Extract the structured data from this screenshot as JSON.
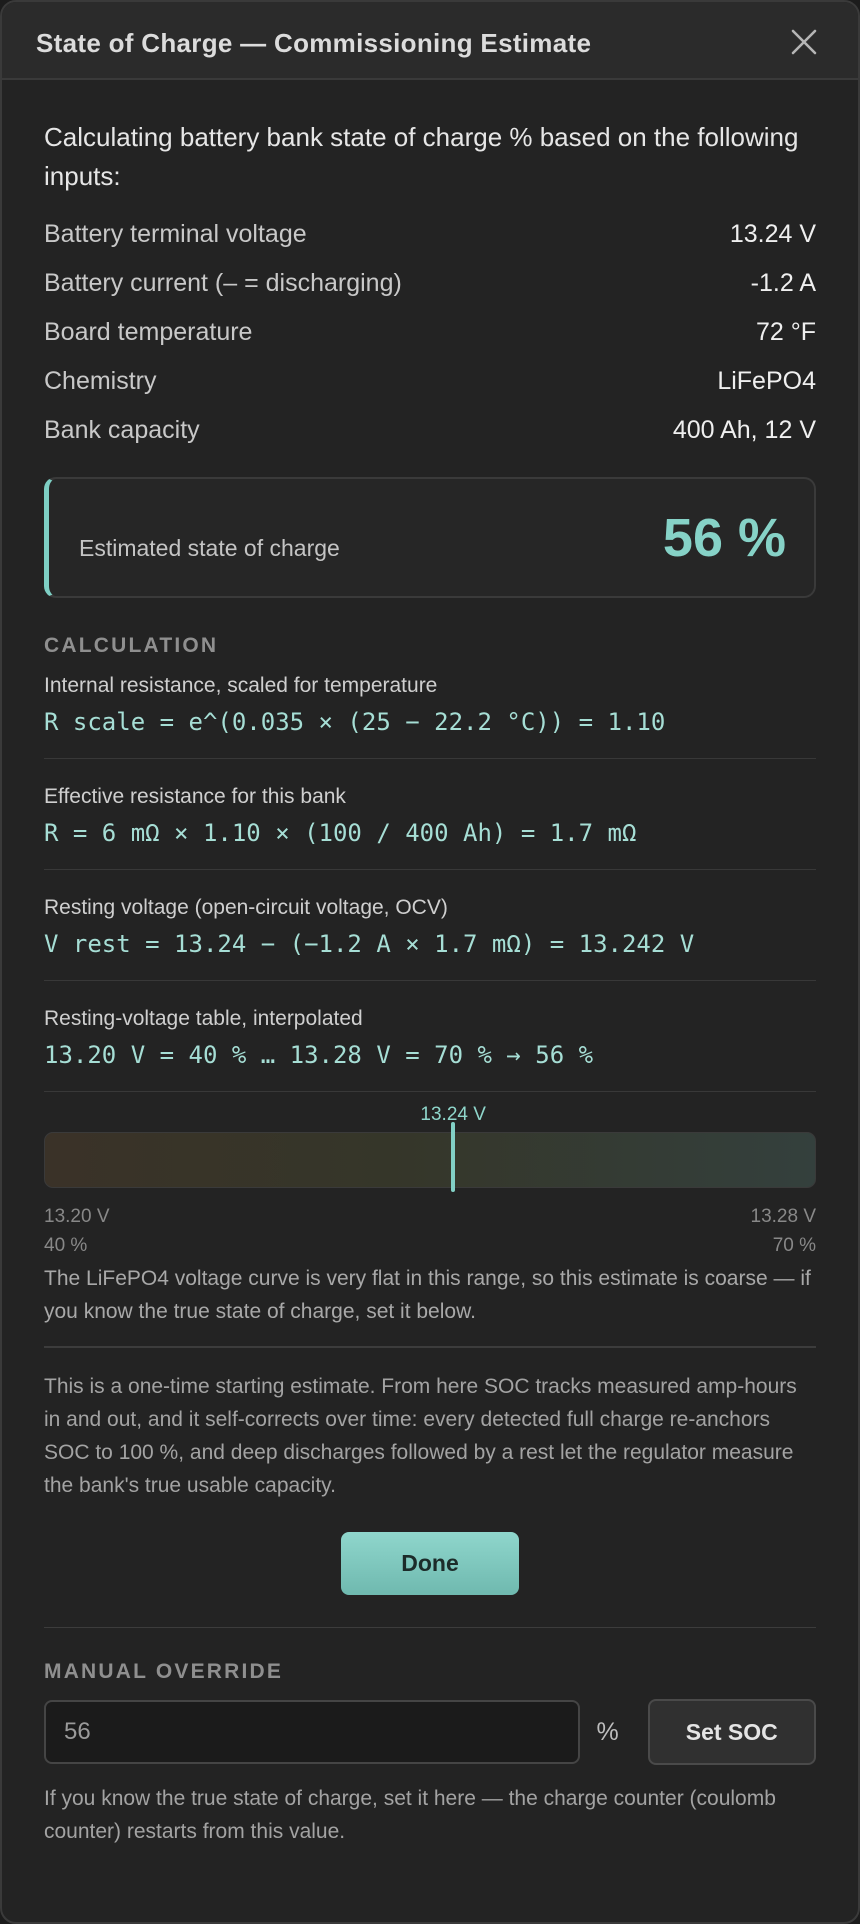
{
  "dialog": {
    "title": "State of Charge — Commissioning Estimate"
  },
  "intro": "Calculating battery bank state of charge % based on the following inputs:",
  "inputs": [
    {
      "label": "Battery terminal voltage",
      "value": "13.24 V"
    },
    {
      "label": "Battery current (– = discharging)",
      "value": "-1.2 A"
    },
    {
      "label": "Board temperature",
      "value": "72 °F"
    },
    {
      "label": "Chemistry",
      "value": "LiFePO4"
    },
    {
      "label": "Bank capacity",
      "value": "400 Ah, 12 V"
    }
  ],
  "estimate": {
    "label": "Estimated state of charge",
    "value": "56 %"
  },
  "calculation": {
    "title": "CALCULATION",
    "steps": [
      {
        "desc": "Internal resistance, scaled for temperature",
        "formula": "R scale = e^(0.035 × (25 − 22.2 °C)) = 1.10"
      },
      {
        "desc": "Effective resistance for this bank",
        "formula": "R = 6 mΩ × 1.10 × (100 / 400 Ah) = 1.7 mΩ"
      },
      {
        "desc": "Resting voltage (open-circuit voltage, OCV)",
        "formula": "V rest = 13.24 − (−1.2 A × 1.7 mΩ) = 13.242 V"
      },
      {
        "desc": "Resting-voltage table, interpolated",
        "formula": "13.20 V = 40 % … 13.28 V = 70 % → 56 %"
      }
    ]
  },
  "gauge": {
    "marker_label": "13.24 V",
    "marker_fraction": 0.53,
    "min_voltage": "13.20 V",
    "min_soc": "40 %",
    "max_voltage": "13.28 V",
    "max_soc": "70 %",
    "note": "The LiFePO4 voltage curve is very flat in this range, so this estimate is coarse — if you know the true state of charge, set it below."
  },
  "info": "This is a one-time starting estimate. From here SOC tracks measured amp-hours in and out, and it self-corrects over time: every detected full charge re-anchors SOC to 100 %, and deep discharges followed by a rest let the regulator measure the bank's true usable capacity.",
  "done_label": "Done",
  "override": {
    "title": "MANUAL OVERRIDE",
    "input_value": "56",
    "unit": "%",
    "button_label": "Set SOC",
    "note": "If you know the true state of charge, set it here — the charge counter (coulomb counter) restarts from this value."
  },
  "colors": {
    "accent": "#86d2c7",
    "background": "#232323"
  }
}
